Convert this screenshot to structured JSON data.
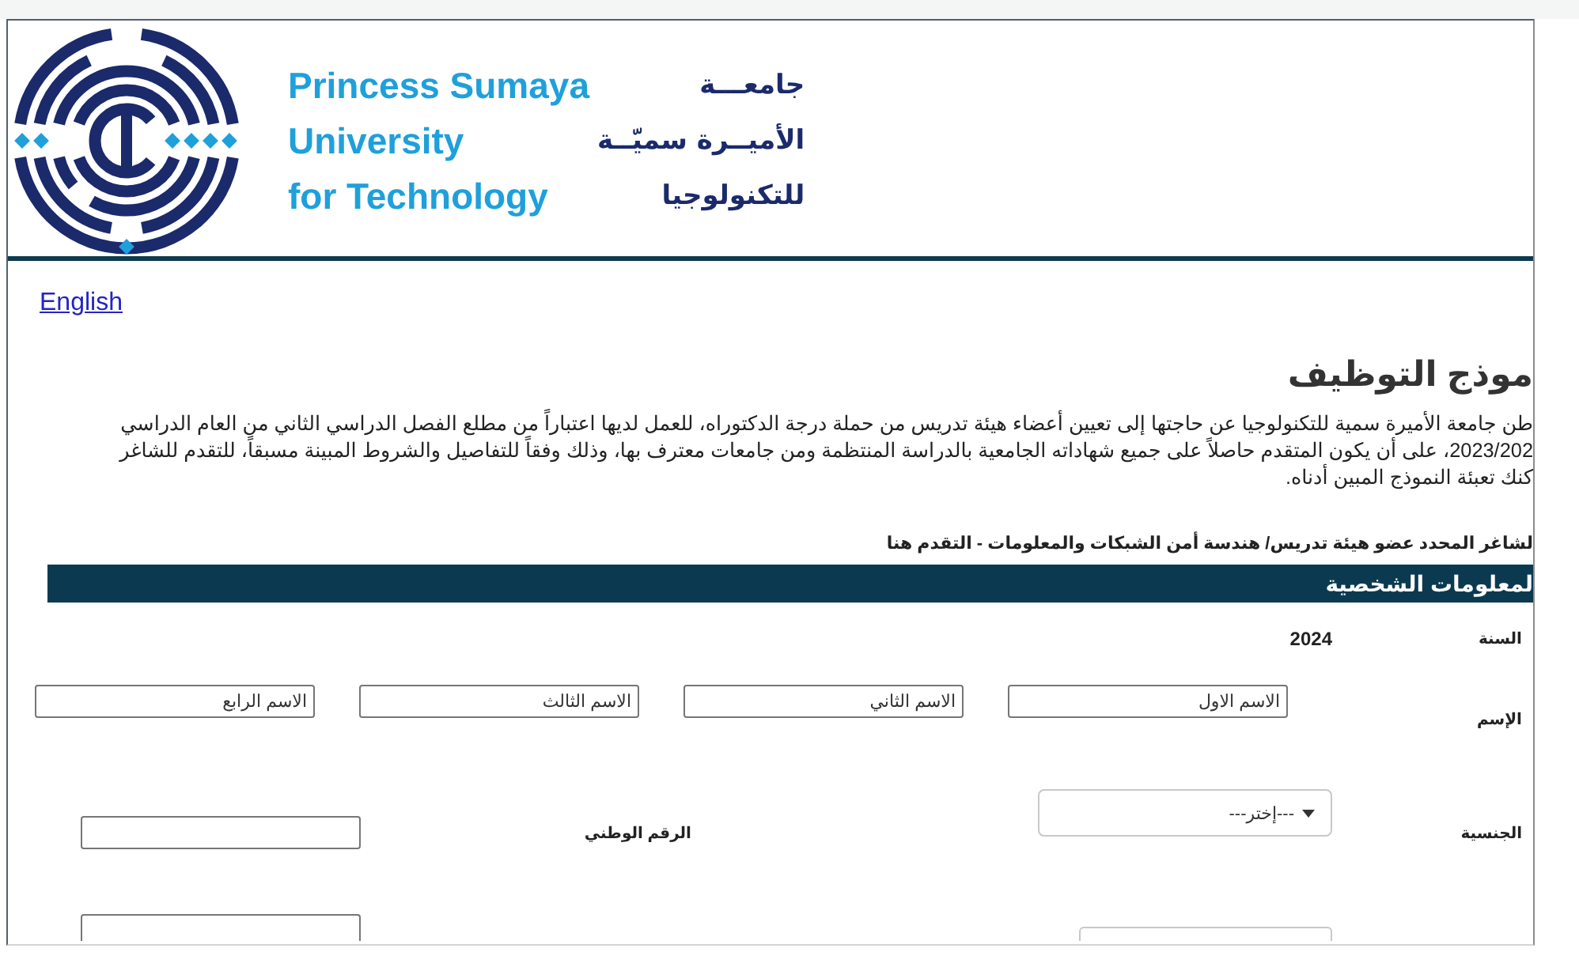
{
  "header": {
    "logo": {
      "english_lines": [
        "Princess Sumaya",
        "University",
        "for Technology"
      ],
      "arabic_lines": [
        "جامعـــة",
        "الأميــرة سميّــة",
        "للتكنولوجيا"
      ]
    }
  },
  "language_link": "English",
  "title": "موذج التوظيف",
  "intro": {
    "lines": [
      "طن جامعة الأميرة سمية للتكنولوجيا عن حاجتها إلى تعيين أعضاء هيئة تدريس من حملة درجة الدكتوراه، للعمل لديها اعتباراً من مطلع الفصل الدراسي الثاني من العام الدراسي",
      "2023/202، على أن يكون المتقدم حاصلاً على جميع شهاداته الجامعية بالدراسة المنتظمة ومن جامعات معترف بها، وذلك وفقاً للتفاصيل والشروط المبينة مسبقاً، للتقدم للشاغر",
      "كنك تعبئة النموذج المبين أدناه."
    ]
  },
  "vacancy_line": "لشاغر المحدد عضو هيئة تدريس/ هندسة أمن الشبكات والمعلومات - التقدم هنا",
  "section": {
    "title": "لمعلومات الشخصية",
    "rows": [
      {
        "kind": "pairs",
        "pairs": [
          {
            "label": "السنة",
            "field": {
              "kind": "value",
              "text": "2024"
            }
          }
        ]
      },
      {
        "kind": "names",
        "label": "الإسم",
        "fields": [
          {
            "placeholder": "الاسم الاول"
          },
          {
            "placeholder": "الاسم الثاني"
          },
          {
            "placeholder": "الاسم الثالث"
          },
          {
            "placeholder": "الاسم الرابع"
          }
        ]
      },
      {
        "kind": "pairs",
        "pairs": [
          {
            "label": "الجنسية",
            "field": {
              "kind": "select",
              "value": "---إختر---"
            }
          },
          {
            "label": "الرقم الوطني",
            "field": {
              "kind": "input"
            }
          }
        ]
      },
      {
        "kind": "pairs",
        "pairs": [
          {
            "field": {
              "kind": "plain"
            }
          },
          {
            "field": {
              "kind": "input"
            }
          }
        ]
      }
    ]
  }
}
